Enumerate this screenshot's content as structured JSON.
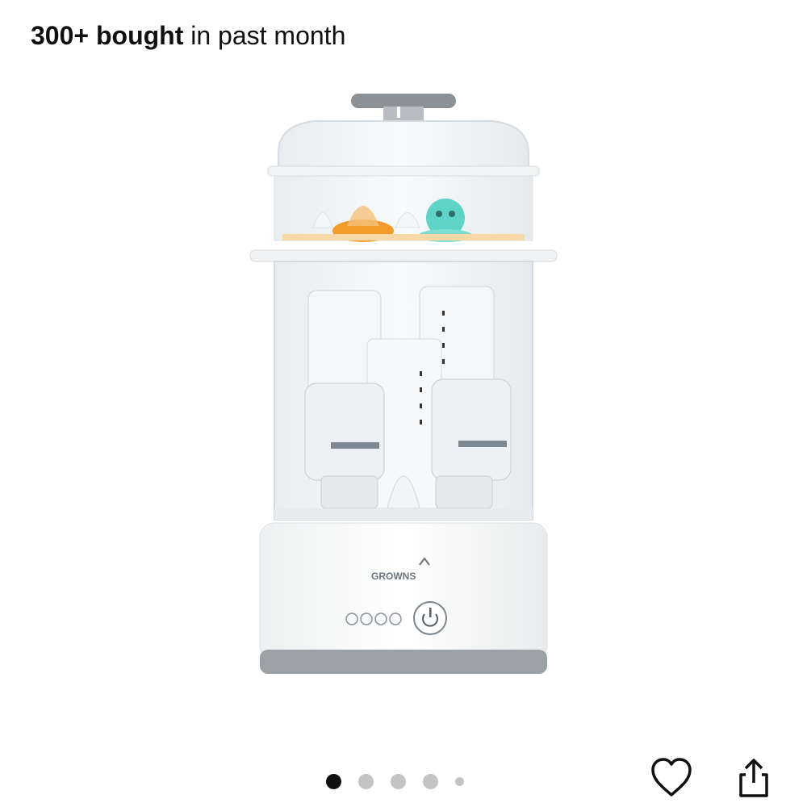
{
  "header": {
    "bought_count": "300+ bought",
    "bought_suffix": " in past month"
  },
  "product": {
    "image_alt": "Baby bottle sterilizer and dryer",
    "brand_logo_text": "GROWNS"
  },
  "carousel": {
    "total_dots": 5,
    "active_index": 0
  },
  "actions": {
    "wishlist_icon": "heart-outline-icon",
    "share_icon": "share-icon"
  },
  "colors": {
    "text": "#0f1111",
    "dot_active": "#0f1111",
    "dot_inactive": "#c4c4c4",
    "accent_orange": "#f39a2a",
    "accent_teal": "#5fd3c6"
  }
}
